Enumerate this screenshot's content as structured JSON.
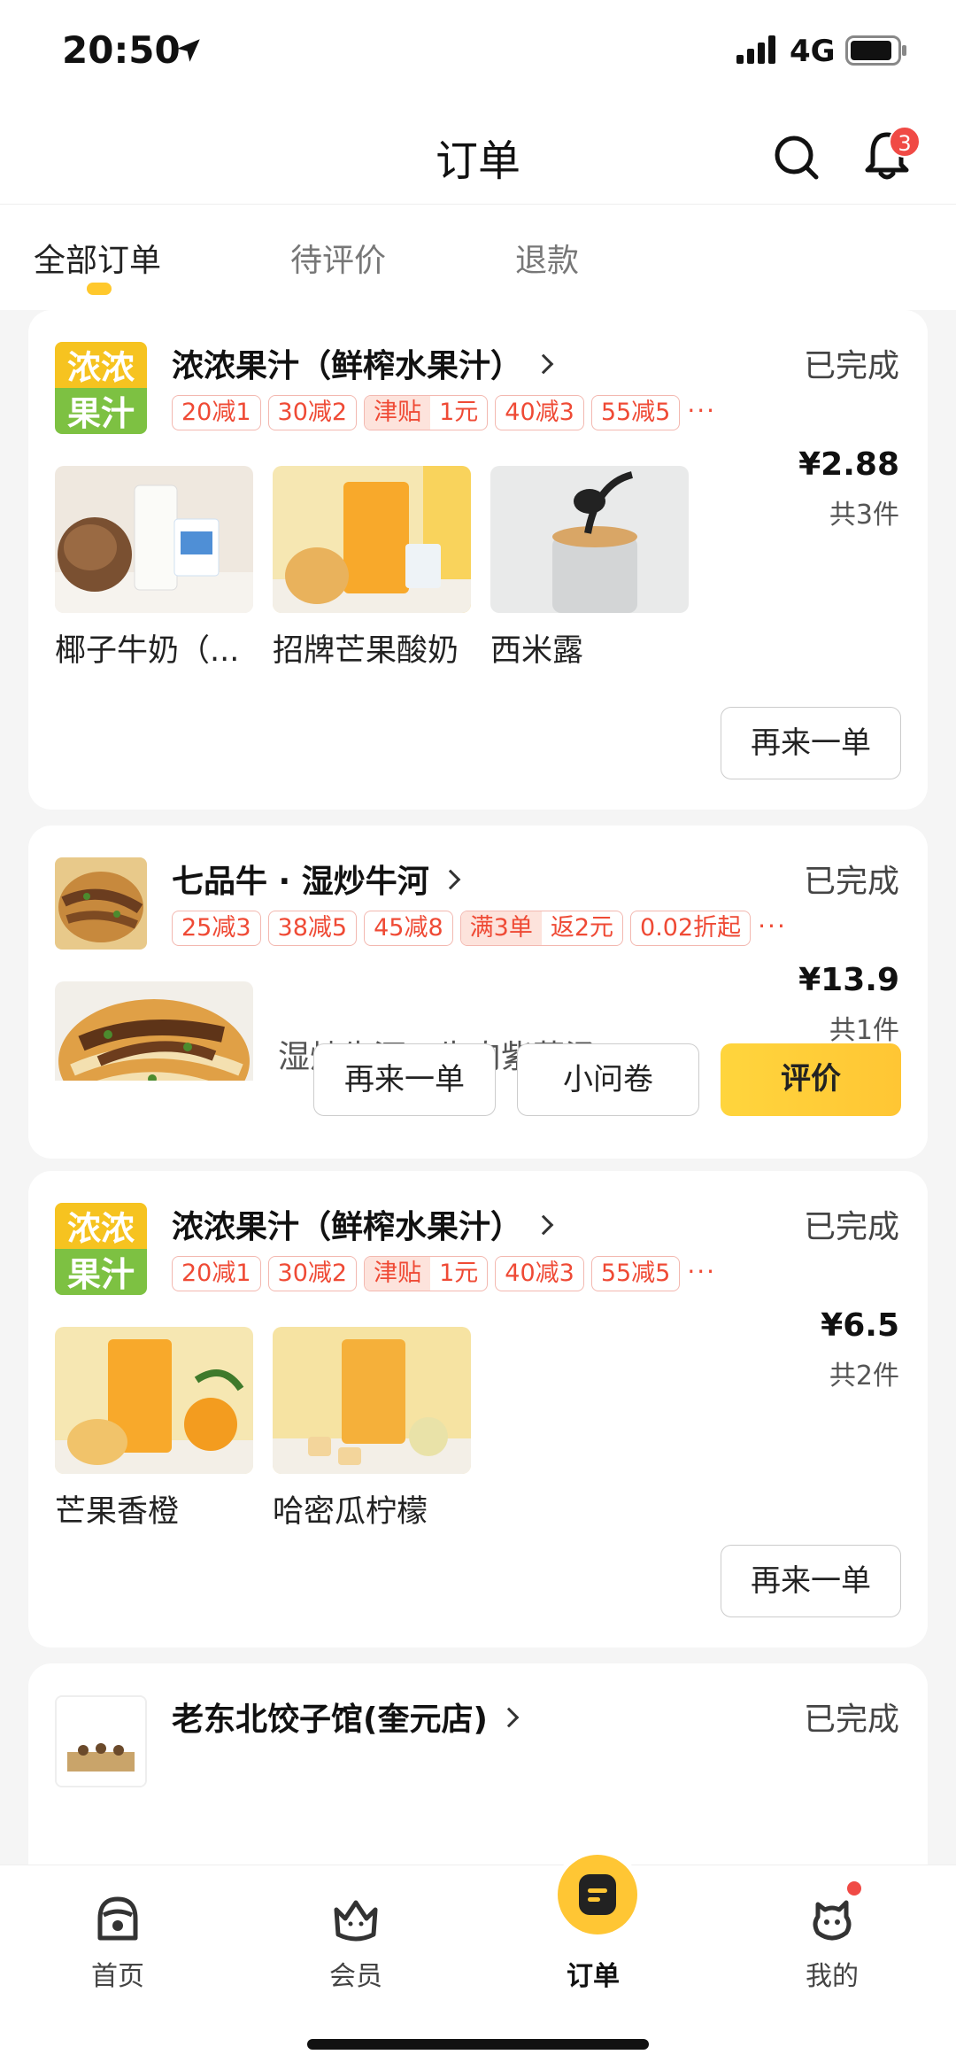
{
  "status_bar": {
    "time": "20:50",
    "network": "4G"
  },
  "header": {
    "title": "订单",
    "notification_count": "3"
  },
  "tabs": [
    {
      "label": "全部订单",
      "active": true
    },
    {
      "label": "待评价",
      "active": false
    },
    {
      "label": "退款",
      "active": false
    }
  ],
  "orders": [
    {
      "shop": "浓浓果汁（鲜榨水果汁）",
      "status": "已完成",
      "promos": [
        "20减1",
        "30减2",
        "40减3",
        "55减5"
      ],
      "promo_dual": {
        "left": "津贴",
        "right": "1元"
      },
      "more": "···",
      "items": [
        "椰子牛奶（...",
        "招牌芒果酸奶",
        "西米露"
      ],
      "price": "¥2.88",
      "count": "共3件",
      "buttons": {
        "reorder": "再来一单"
      }
    },
    {
      "shop": "七品牛 · 湿炒牛河",
      "status": "已完成",
      "promos": [
        "25减3",
        "38减5",
        "45减8",
        "0.02折起"
      ],
      "promo_dual": {
        "left": "满3单",
        "right": "返2元"
      },
      "more": "···",
      "item_desc": "湿炒牛河＋牛肉紫菜汤",
      "price": "¥13.9",
      "count": "共1件",
      "buttons": {
        "reorder": "再来一单",
        "survey": "小问卷",
        "review": "评价"
      }
    },
    {
      "shop": "浓浓果汁（鲜榨水果汁）",
      "status": "已完成",
      "promos": [
        "20减1",
        "30减2",
        "40减3",
        "55减5"
      ],
      "promo_dual": {
        "left": "津贴",
        "right": "1元"
      },
      "more": "···",
      "items": [
        "芒果香橙",
        "哈密瓜柠檬"
      ],
      "price": "¥6.5",
      "count": "共2件",
      "buttons": {
        "reorder": "再来一单"
      }
    },
    {
      "shop": "老东北饺子馆(奎元店)",
      "status": "已完成"
    }
  ],
  "logo_text": {
    "line1": "浓浓",
    "line2": "果汁"
  },
  "bottom_nav": [
    {
      "label": "首页",
      "icon": "home-face-icon"
    },
    {
      "label": "会员",
      "icon": "member-crown-icon"
    },
    {
      "label": "订单",
      "icon": "order-icon",
      "active": true
    },
    {
      "label": "我的",
      "icon": "profile-icon"
    }
  ],
  "colors": {
    "accent": "#ffc634",
    "promo_red": "#ef4a35",
    "badge_red": "#f04a45"
  }
}
